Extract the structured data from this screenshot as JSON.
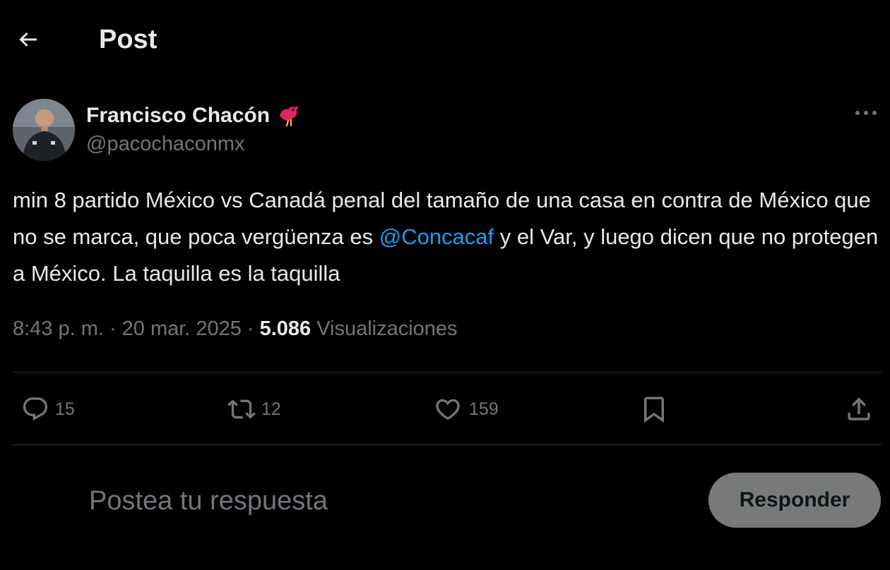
{
  "header": {
    "title": "Post"
  },
  "author": {
    "display_name": "Francisco Chacón",
    "handle": "@pacochaconmx"
  },
  "tweet": {
    "text_part1": "min 8 partido México vs Canadá penal del tamaño de una casa en contra de México que no se marca, que poca vergüenza es ",
    "mention": "@Concacaf",
    "text_part2": "  y el Var, y luego dicen que no protegen a México. La taquilla es la taquilla",
    "time": "8:43 p. m.",
    "separator": "·",
    "date": "20 mar. 2025",
    "views_count": "5.086",
    "views_label": "Visualizaciones"
  },
  "actions": {
    "replies": "15",
    "reposts": "12",
    "likes": "159"
  },
  "reply": {
    "placeholder": "Postea tu respuesta",
    "button_label": "Responder"
  },
  "colors": {
    "background": "#000000",
    "text_primary": "#e7e9ea",
    "text_secondary": "#71767b",
    "link": "#1d9bf0",
    "divider": "#2f3336",
    "reply_button": "#787a7a"
  },
  "icons": [
    "back-arrow-icon",
    "bird-icon",
    "more-icon",
    "reply-icon",
    "repost-icon",
    "like-icon",
    "bookmark-icon",
    "share-icon"
  ]
}
